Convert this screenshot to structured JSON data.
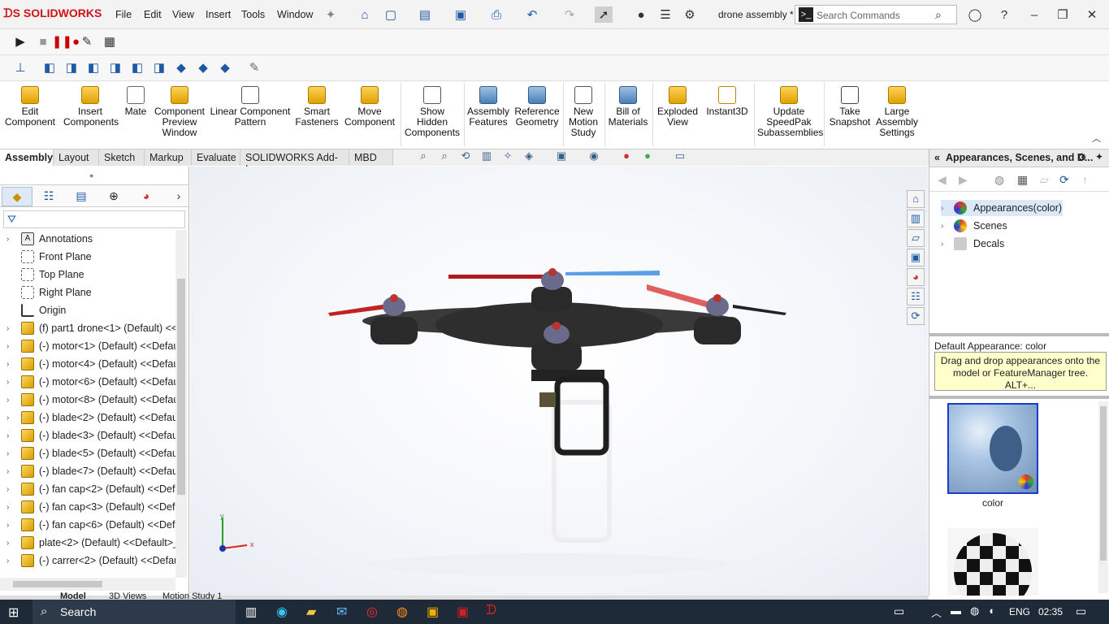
{
  "app": {
    "logo": "SOLIDWORKS",
    "document_title": "drone assembly *"
  },
  "menu": [
    "File",
    "Edit",
    "View",
    "Insert",
    "Tools",
    "Window"
  ],
  "search": {
    "placeholder": "Search Commands"
  },
  "ribbon": {
    "buttons": [
      {
        "label": "Edit Component"
      },
      {
        "label": "Insert Components"
      },
      {
        "label": "Mate"
      },
      {
        "label": "Component Preview Window"
      },
      {
        "label": "Linear Component Pattern"
      },
      {
        "label": "Smart Fasteners"
      },
      {
        "label": "Move Component"
      },
      {
        "label": "Show Hidden Components"
      },
      {
        "label": "Assembly Features"
      },
      {
        "label": "Reference Geometry"
      },
      {
        "label": "New Motion Study"
      },
      {
        "label": "Bill of Materials"
      },
      {
        "label": "Exploded View"
      },
      {
        "label": "Instant3D"
      },
      {
        "label": "Update SpeedPak Subassemblies"
      },
      {
        "label": "Take Snapshot"
      },
      {
        "label": "Large Assembly Settings"
      }
    ]
  },
  "tabs": [
    "Assembly",
    "Layout",
    "Sketch",
    "Markup",
    "Evaluate",
    "SOLIDWORKS Add-Ins",
    "MBD"
  ],
  "feature_tree": {
    "items": [
      {
        "label": "Annotations",
        "icon": "annotation"
      },
      {
        "label": "Front Plane",
        "icon": "plane"
      },
      {
        "label": "Top Plane",
        "icon": "plane"
      },
      {
        "label": "Right Plane",
        "icon": "plane"
      },
      {
        "label": "Origin",
        "icon": "origin"
      },
      {
        "label": "(f) part1 drone<1> (Default) <<",
        "icon": "part"
      },
      {
        "label": "(-) motor<1> (Default) <<Defau",
        "icon": "part"
      },
      {
        "label": "(-) motor<4> (Default) <<Defau",
        "icon": "part"
      },
      {
        "label": "(-) motor<6> (Default) <<Defau",
        "icon": "part"
      },
      {
        "label": "(-) motor<8> (Default) <<Defau",
        "icon": "part"
      },
      {
        "label": "(-) blade<2> (Default) <<Defau",
        "icon": "part"
      },
      {
        "label": "(-) blade<3> (Default) <<Defau",
        "icon": "part"
      },
      {
        "label": "(-) blade<5> (Default) <<Defau",
        "icon": "part"
      },
      {
        "label": "(-) blade<7> (Default) <<Defau",
        "icon": "part"
      },
      {
        "label": "(-) fan cap<2> (Default) <<Def",
        "icon": "part"
      },
      {
        "label": "(-) fan cap<3> (Default) <<Def",
        "icon": "part"
      },
      {
        "label": "(-) fan cap<6> (Default) <<Def",
        "icon": "part"
      },
      {
        "label": "plate<2> (Default) <<Default>_",
        "icon": "part"
      },
      {
        "label": "(-) carrer<2> (Default) <<Defau",
        "icon": "part"
      }
    ]
  },
  "bottom_tabs": [
    "Model",
    "3D Views",
    "Motion Study 1"
  ],
  "triad": {
    "x": "x",
    "y": "y"
  },
  "task_pane": {
    "title": "Appearances, Scenes, and D...",
    "tree": [
      {
        "label": "Appearances(color)",
        "selected": true
      },
      {
        "label": "Scenes",
        "selected": false
      },
      {
        "label": "Decals",
        "selected": false
      }
    ],
    "default_appearance": "Default Appearance: color",
    "tooltip": "Drag and drop appearances onto the model or FeatureManager tree.  ALT+...",
    "swatches": [
      {
        "label": "color"
      }
    ]
  },
  "taskbar": {
    "search": "Search",
    "language": "ENG",
    "time": "02:35"
  }
}
